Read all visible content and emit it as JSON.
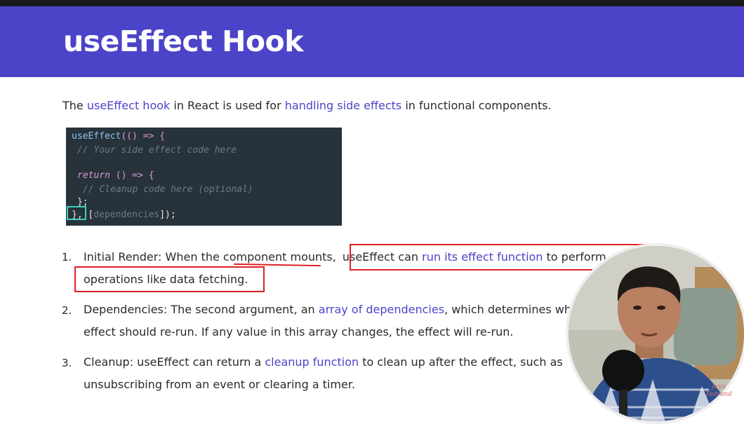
{
  "slide": {
    "title": "useEffect Hook",
    "intro": {
      "t1": "The ",
      "h1": "useEffect hook",
      "t2": " in React is used for ",
      "h2": "handling side effects",
      "t3": " in functional components."
    }
  },
  "code": {
    "l1_fn": "useEffect",
    "l1_rest": "(() => {",
    "l2": "// Your side effect code here",
    "l3_kw": "return",
    "l3_rest": " () => {",
    "l4": "// Cleanup code here (optional)",
    "l5": "};",
    "l6_a": "}, [",
    "l6_b": "dependencies",
    "l6_c": "]);"
  },
  "list": {
    "item1": {
      "num": "1.",
      "a": "Initial Render:  When the component mounts,",
      "b": "useEffect can ",
      "c": "run its effect function",
      "d": " to perform",
      "line2": "operations like data fetching."
    },
    "item2": {
      "num": "2.",
      "a": "Dependencies: The second argument, an ",
      "b": "array of dependencies",
      "c": ", which determines when the",
      "line2": "effect should re-run. If any value in this array changes, the effect will re-run."
    },
    "item3": {
      "num": "3.",
      "a": "Cleanup: useEffect can return a ",
      "b": "cleanup function",
      "c": " to clean up after the effect, such as",
      "line2": "unsubscribing from an event or clearing a timer."
    }
  },
  "watermark": {
    "line1": "Jayu",
    "line2": "Tedrond"
  }
}
